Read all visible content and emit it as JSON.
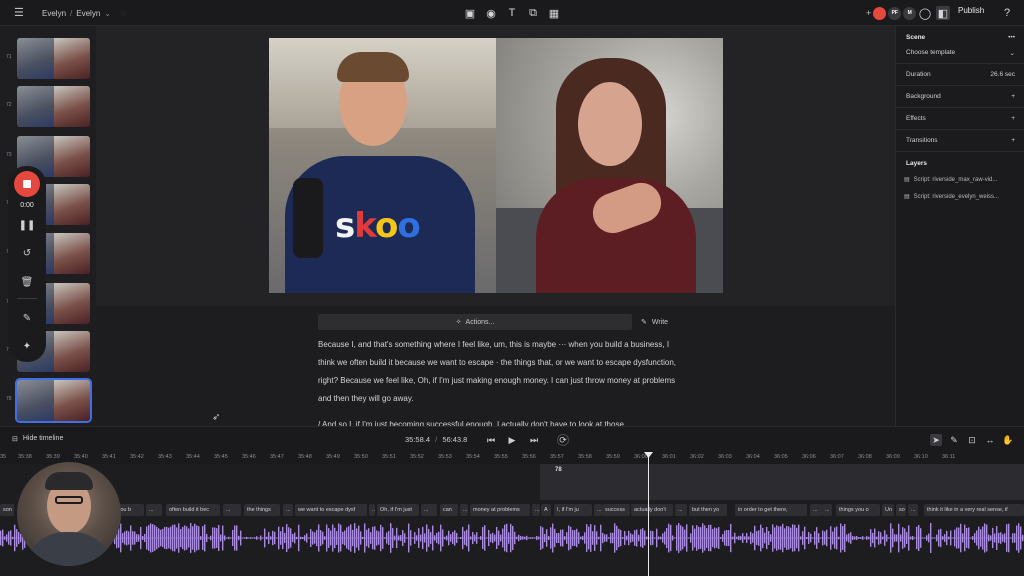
{
  "topbar": {
    "breadcrumb_project": "Evelyn",
    "breadcrumb_sep": "/",
    "breadcrumb_file": "Evelyn",
    "publish_label": "Publish",
    "avatars": [
      {
        "initials": "",
        "color": "#e5483f"
      },
      {
        "initials": "PF",
        "color": "#3a3a3e"
      },
      {
        "initials": "M",
        "color": "#3a3a3e"
      }
    ]
  },
  "thumbs": {
    "numbers": [
      "71",
      "72",
      "73",
      "74",
      "75",
      "76",
      "77",
      "78"
    ]
  },
  "recorder": {
    "time": "0:00"
  },
  "preview": {
    "brand_text": "skoo",
    "brand_letter_colors": [
      "#f2f2f2",
      "#e03a3a",
      "#f5c518",
      "#2f6fe0"
    ]
  },
  "script": {
    "actions_label": "Actions...",
    "write_label": "Write",
    "paragraph1": "Because I, and that's something where I feel like, um, this is maybe ··· when you build a business, I think we often build it because we want to escape · the things that, or we want to escape dysfunction, right? Because we feel like, Oh, if I'm just making enough money. I can just throw money at problems and then they will go away.",
    "paragraph2": "/ And so I, if I'm just becoming successful enough, I actually don't have to look at those"
  },
  "rightpanel": {
    "scene_title": "Scene",
    "choose_template": "Choose template",
    "duration_label": "Duration",
    "duration_value": "26.6 sec",
    "background_label": "Background",
    "effects_label": "Effects",
    "transitions_label": "Transitions",
    "layers_title": "Layers",
    "layers": [
      "Script: riverside_max_raw-vid...",
      "Script: riverside_evelyn_weiss..."
    ]
  },
  "timeline": {
    "hide_label": "Hide timeline",
    "current_time": "35:58.4",
    "separator": "/",
    "total_time": "56:43.8",
    "ruler": [
      "35",
      "35:38",
      "35:39",
      "35:40",
      "35:41",
      "35:42",
      "35:43",
      "35:44",
      "35:45",
      "35:46",
      "35:47",
      "35:48",
      "35:49",
      "35:50",
      "35:51",
      "35:52",
      "35:53",
      "35:54",
      "35:55",
      "35:56",
      "35:57",
      "35:58",
      "35:59",
      "36:00",
      "36:01",
      "36:02",
      "36:03",
      "36:04",
      "36:05",
      "36:06",
      "36:07",
      "36:08",
      "36:09",
      "36:10",
      "36:11"
    ],
    "clip_number": "78",
    "words": [
      "son",
      "n you b",
      "...",
      "often build it bec",
      "...",
      "the things",
      "...",
      "we want to escape dysf",
      "...",
      "Oh, if I'm just",
      "...",
      "can",
      "...",
      "money at problems",
      "...",
      "A",
      "I, if I'm ju",
      "...",
      "success",
      "actually don't",
      "...",
      "but then yo",
      "in order to get there,",
      "...",
      "...",
      "things you o",
      "Un",
      "so",
      "...",
      "think it like in a very real sense, if"
    ]
  }
}
